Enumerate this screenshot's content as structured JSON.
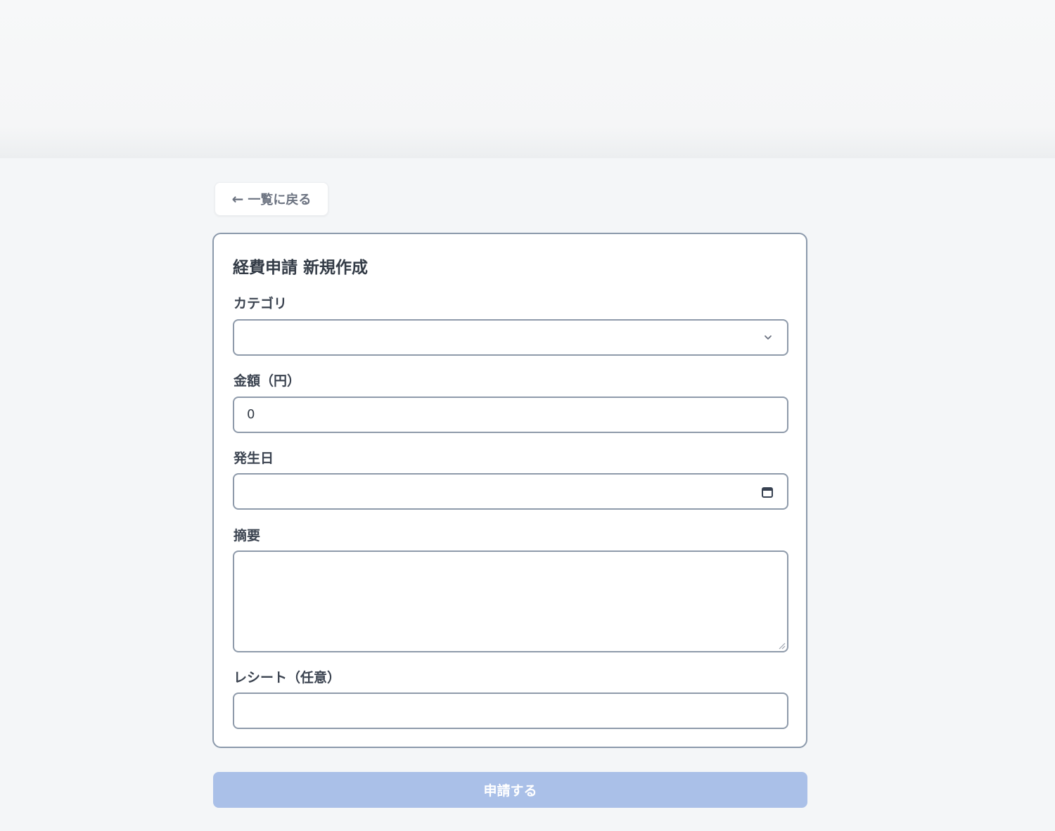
{
  "back_button": {
    "arrow": "←",
    "label": "一覧に戻る"
  },
  "form": {
    "title": "経費申請 新規作成",
    "fields": {
      "category": {
        "label": "カテゴリ",
        "value": "",
        "icon": "chevron-down-icon"
      },
      "amount": {
        "label": "金額（円）",
        "value": "0"
      },
      "date": {
        "label": "発生日",
        "value": "",
        "icon": "calendar-icon"
      },
      "summary": {
        "label": "摘要",
        "value": ""
      },
      "receipt": {
        "label": "レシート（任意）",
        "value": ""
      }
    }
  },
  "submit_button": {
    "label": "申請する",
    "enabled": false
  },
  "colors": {
    "background": "#f4f6f8",
    "card_border": "#8b99ab",
    "submit_disabled": "#aac0e8"
  }
}
